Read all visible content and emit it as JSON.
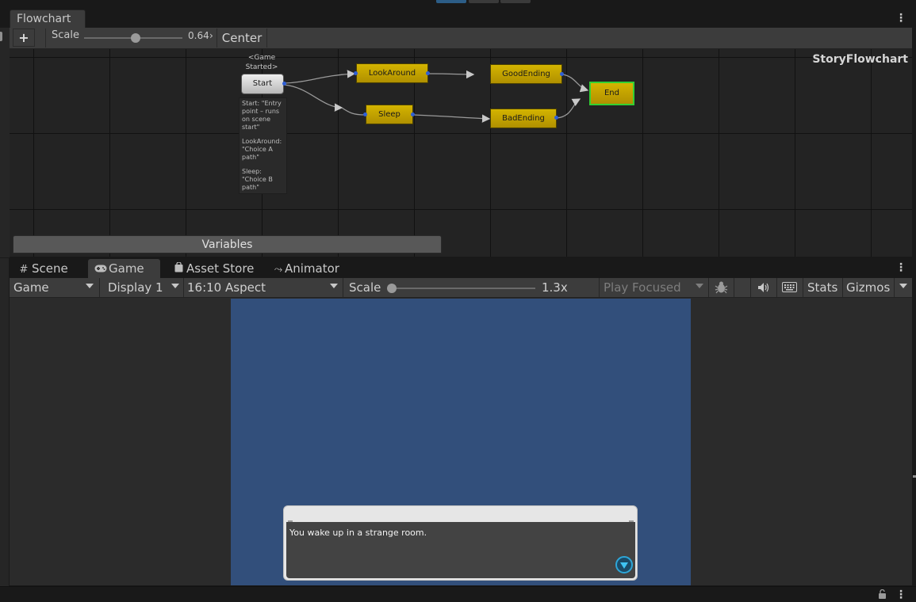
{
  "flowchart": {
    "tab_label": "Flowchart",
    "add_label": "+",
    "scale_label": "Scale",
    "scale_value": "0.64",
    "center_label": "Center",
    "flowchart_name": "StoryFlowchart",
    "variables_label": "Variables",
    "start": {
      "event_label": "<Game Started>",
      "label": "Start",
      "descriptions": [
        "Start: \"Entry point – runs on scene start\"",
        "LookAround: \"Choice A path\"",
        "Sleep: \"Choice B path\""
      ]
    },
    "blocks": {
      "look_around": "LookAround",
      "sleep": "Sleep",
      "good_ending": "GoodEnding",
      "bad_ending": "BadEnding",
      "end": "End"
    }
  },
  "game_window": {
    "tabs": [
      {
        "label": "Scene",
        "icon": "hash-icon"
      },
      {
        "label": "Game",
        "icon": "gamepad-icon"
      },
      {
        "label": "Asset Store",
        "icon": "bag-icon"
      },
      {
        "label": "Animator",
        "icon": "fork-icon"
      }
    ],
    "toolbar": {
      "mode": "Game",
      "display": "Display 1",
      "aspect": "16:10 Aspect",
      "scale_label": "Scale",
      "scale_value": "1.3x",
      "play_focused": "Play Focused",
      "stats": "Stats",
      "gizmos": "Gizmos"
    },
    "dialog": {
      "text": "You wake up in a strange room."
    }
  },
  "colors": {
    "block_yellow": "#c8a800",
    "start_gray": "#d8d8d8",
    "active_outline": "#33d033",
    "game_background": "#324f7b",
    "dialog_accent": "#2da6d8"
  }
}
